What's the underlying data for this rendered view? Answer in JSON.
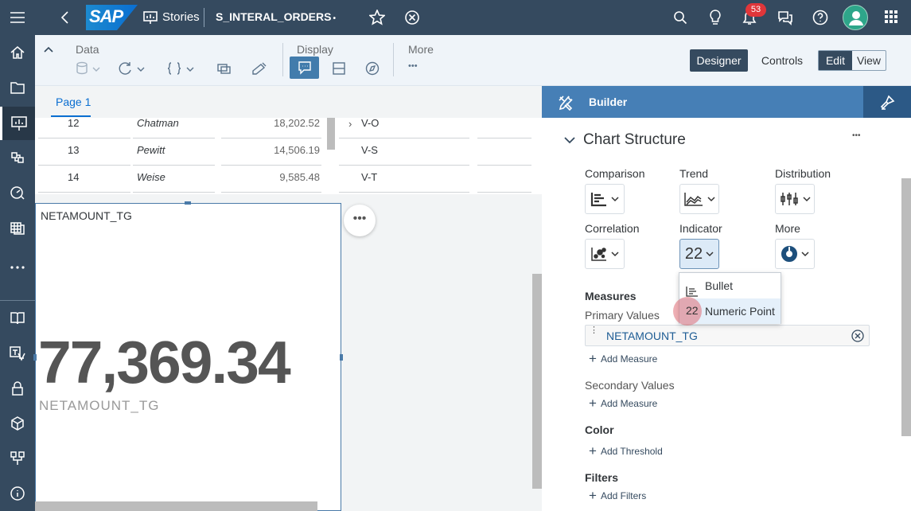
{
  "shell": {
    "logo": "SAP",
    "stories_label": "Stories",
    "story_name": "S_INTERAL_ORDERS",
    "dirty_marker": "•",
    "notification_count": "53"
  },
  "toolbar": {
    "data_label": "Data",
    "display_label": "Display",
    "more_label": "More",
    "more_dots": "•••",
    "designer_label": "Designer",
    "controls_label": "Controls",
    "edit_label": "Edit",
    "view_label": "View"
  },
  "page_tab": "Page 1",
  "table": {
    "rows": [
      {
        "num": "12",
        "name": "Chatman",
        "amount": "18,202.52",
        "code": "V-O"
      },
      {
        "num": "13",
        "name": "Pewitt",
        "amount": "14,506.19",
        "code": "V-S"
      },
      {
        "num": "14",
        "name": "Weise",
        "amount": "9,585.48",
        "code": "V-T"
      }
    ]
  },
  "tile": {
    "title": "NETAMOUNT_TG",
    "value": "77,369.34",
    "subtitle": "NETAMOUNT_TG",
    "more_dots": "•••"
  },
  "builder": {
    "title": "Builder",
    "section": "Chart Structure",
    "section_dots": "•••",
    "types": {
      "comparison": "Comparison",
      "trend": "Trend",
      "distribution": "Distribution",
      "correlation": "Correlation",
      "indicator": "Indicator",
      "more": "More"
    },
    "indicator_glyph": "22",
    "dropdown": {
      "bullet": "Bullet",
      "numeric_point": "Numeric Point",
      "numeric_glyph": "22"
    },
    "measures_label": "Measures",
    "primary_values_label": "Primary Values",
    "primary_measure": "NETAMOUNT_TG",
    "add_measure": "Add Measure",
    "secondary_values_label": "Secondary Values",
    "add_measure_2": "Add Measure",
    "color_label": "Color",
    "add_threshold": "Add Threshold",
    "filters_label": "Filters",
    "add_filters": "Add Filters"
  }
}
